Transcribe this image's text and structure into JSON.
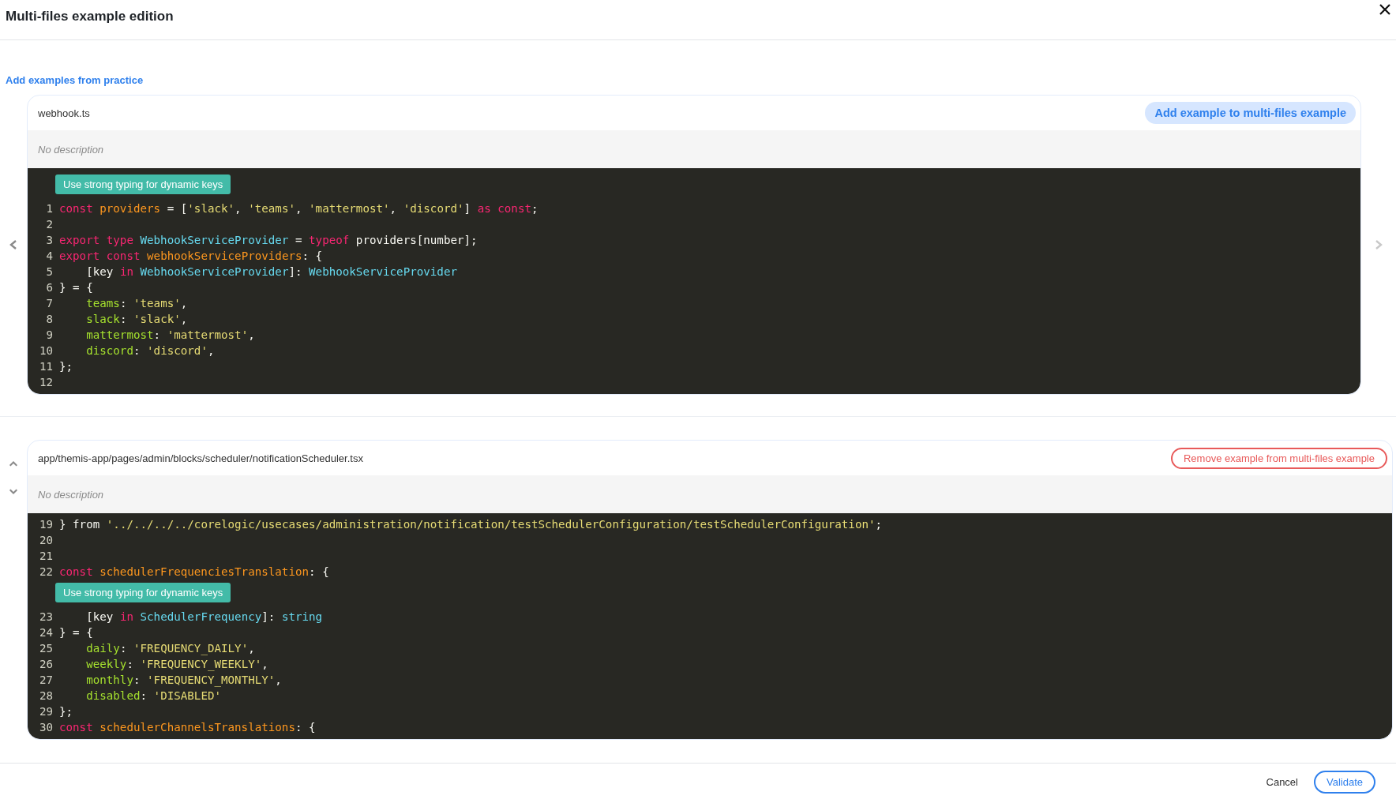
{
  "dialog": {
    "title": "Multi-files example edition"
  },
  "practice_link": "Add examples from practice",
  "examples": [
    {
      "kind": "carousel",
      "path": "webhook.ts",
      "action": {
        "kind": "add",
        "label": "Add example to multi-files example"
      },
      "description": "No description",
      "lines": [
        {
          "kind": "annotation",
          "text": "Use strong typing for dynamic keys"
        },
        {
          "kind": "code",
          "number": "1",
          "tokens": [
            {
              "kind": "keyword",
              "text": "const "
            },
            {
              "kind": "definition",
              "text": "providers"
            },
            {
              "kind": "plain",
              "text": " = ["
            },
            {
              "kind": "string",
              "text": "'slack'"
            },
            {
              "kind": "plain",
              "text": ", "
            },
            {
              "kind": "string",
              "text": "'teams'"
            },
            {
              "kind": "plain",
              "text": ", "
            },
            {
              "kind": "string",
              "text": "'mattermost'"
            },
            {
              "kind": "plain",
              "text": ", "
            },
            {
              "kind": "string",
              "text": "'discord'"
            },
            {
              "kind": "plain",
              "text": "] "
            },
            {
              "kind": "keyword",
              "text": "as const"
            },
            {
              "kind": "plain",
              "text": ";"
            }
          ]
        },
        {
          "kind": "code",
          "number": "2"
        },
        {
          "kind": "code",
          "number": "3",
          "tokens": [
            {
              "kind": "keyword",
              "text": "export type "
            },
            {
              "kind": "type",
              "text": "WebhookServiceProvider"
            },
            {
              "kind": "plain",
              "text": " = "
            },
            {
              "kind": "keyword",
              "text": "typeof"
            },
            {
              "kind": "plain",
              "text": " providers[number];"
            }
          ]
        },
        {
          "kind": "code",
          "number": "4",
          "tokens": [
            {
              "kind": "keyword",
              "text": "export const "
            },
            {
              "kind": "definition",
              "text": "webhookServiceProviders"
            },
            {
              "kind": "plain",
              "text": ": {"
            }
          ]
        },
        {
          "kind": "code",
          "number": "5",
          "tokens": [
            {
              "kind": "plain",
              "text": "    [key "
            },
            {
              "kind": "keyword",
              "text": "in"
            },
            {
              "kind": "type",
              "text": " WebhookServiceProvider"
            },
            {
              "kind": "plain",
              "text": "]: "
            },
            {
              "kind": "type",
              "text": "WebhookServiceProvider"
            }
          ]
        },
        {
          "kind": "code",
          "number": "6",
          "tokens": [
            {
              "kind": "plain",
              "text": "} = {"
            }
          ]
        },
        {
          "kind": "code",
          "number": "7",
          "tokens": [
            {
              "kind": "property",
              "text": "    teams"
            },
            {
              "kind": "plain",
              "text": ": "
            },
            {
              "kind": "string",
              "text": "'teams'"
            },
            {
              "kind": "plain",
              "text": ","
            }
          ]
        },
        {
          "kind": "code",
          "number": "8",
          "tokens": [
            {
              "kind": "property",
              "text": "    slack"
            },
            {
              "kind": "plain",
              "text": ": "
            },
            {
              "kind": "string",
              "text": "'slack'"
            },
            {
              "kind": "plain",
              "text": ","
            }
          ]
        },
        {
          "kind": "code",
          "number": "9",
          "tokens": [
            {
              "kind": "property",
              "text": "    mattermost"
            },
            {
              "kind": "plain",
              "text": ": "
            },
            {
              "kind": "string",
              "text": "'mattermost'"
            },
            {
              "kind": "plain",
              "text": ","
            }
          ]
        },
        {
          "kind": "code",
          "number": "10",
          "tokens": [
            {
              "kind": "property",
              "text": "    discord"
            },
            {
              "kind": "plain",
              "text": ": "
            },
            {
              "kind": "string",
              "text": "'discord'"
            },
            {
              "kind": "plain",
              "text": ","
            }
          ]
        },
        {
          "kind": "code",
          "number": "11",
          "tokens": [
            {
              "kind": "plain",
              "text": "};"
            }
          ]
        },
        {
          "kind": "code",
          "number": "12"
        }
      ]
    },
    {
      "kind": "reorder",
      "path": "app/themis-app/pages/admin/blocks/scheduler/notificationScheduler.tsx",
      "action": {
        "kind": "remove",
        "label": "Remove example from multi-files example"
      },
      "description": "No description",
      "lines": [
        {
          "kind": "code",
          "number": "19",
          "tokens": [
            {
              "kind": "plain",
              "text": "} from "
            },
            {
              "kind": "string",
              "text": "'../../../../corelogic/usecases/administration/notification/testSchedulerConfiguration/testSchedulerConfiguration'"
            },
            {
              "kind": "plain",
              "text": ";"
            }
          ]
        },
        {
          "kind": "code",
          "number": "20"
        },
        {
          "kind": "code",
          "number": "21"
        },
        {
          "kind": "code",
          "number": "22",
          "tokens": [
            {
              "kind": "keyword",
              "text": "const "
            },
            {
              "kind": "definition",
              "text": "schedulerFrequenciesTranslation"
            },
            {
              "kind": "plain",
              "text": ": {"
            }
          ]
        },
        {
          "kind": "annotation",
          "text": "Use strong typing for dynamic keys"
        },
        {
          "kind": "code",
          "number": "23",
          "tokens": [
            {
              "kind": "plain",
              "text": "    [key "
            },
            {
              "kind": "keyword",
              "text": "in"
            },
            {
              "kind": "type",
              "text": " SchedulerFrequency"
            },
            {
              "kind": "plain",
              "text": "]: "
            },
            {
              "kind": "type",
              "text": "string"
            }
          ]
        },
        {
          "kind": "code",
          "number": "24",
          "tokens": [
            {
              "kind": "plain",
              "text": "} = {"
            }
          ]
        },
        {
          "kind": "code",
          "number": "25",
          "tokens": [
            {
              "kind": "property",
              "text": "    daily"
            },
            {
              "kind": "plain",
              "text": ": "
            },
            {
              "kind": "string",
              "text": "'FREQUENCY_DAILY'"
            },
            {
              "kind": "plain",
              "text": ","
            }
          ]
        },
        {
          "kind": "code",
          "number": "26",
          "tokens": [
            {
              "kind": "property",
              "text": "    weekly"
            },
            {
              "kind": "plain",
              "text": ": "
            },
            {
              "kind": "string",
              "text": "'FREQUENCY_WEEKLY'"
            },
            {
              "kind": "plain",
              "text": ","
            }
          ]
        },
        {
          "kind": "code",
          "number": "27",
          "tokens": [
            {
              "kind": "property",
              "text": "    monthly"
            },
            {
              "kind": "plain",
              "text": ": "
            },
            {
              "kind": "string",
              "text": "'FREQUENCY_MONTHLY'"
            },
            {
              "kind": "plain",
              "text": ","
            }
          ]
        },
        {
          "kind": "code",
          "number": "28",
          "tokens": [
            {
              "kind": "property",
              "text": "    disabled"
            },
            {
              "kind": "plain",
              "text": ": "
            },
            {
              "kind": "string",
              "text": "'DISABLED'"
            }
          ]
        },
        {
          "kind": "code",
          "number": "29",
          "tokens": [
            {
              "kind": "plain",
              "text": "};"
            }
          ]
        },
        {
          "kind": "code",
          "number": "30",
          "tokens": [
            {
              "kind": "keyword",
              "text": "const "
            },
            {
              "kind": "definition",
              "text": "schedulerChannelsTranslations"
            },
            {
              "kind": "plain",
              "text": ": {"
            }
          ]
        }
      ]
    }
  ],
  "footer_buttons": [
    {
      "kind": "text",
      "label": "Cancel"
    },
    {
      "kind": "outline",
      "label": "Validate"
    }
  ]
}
